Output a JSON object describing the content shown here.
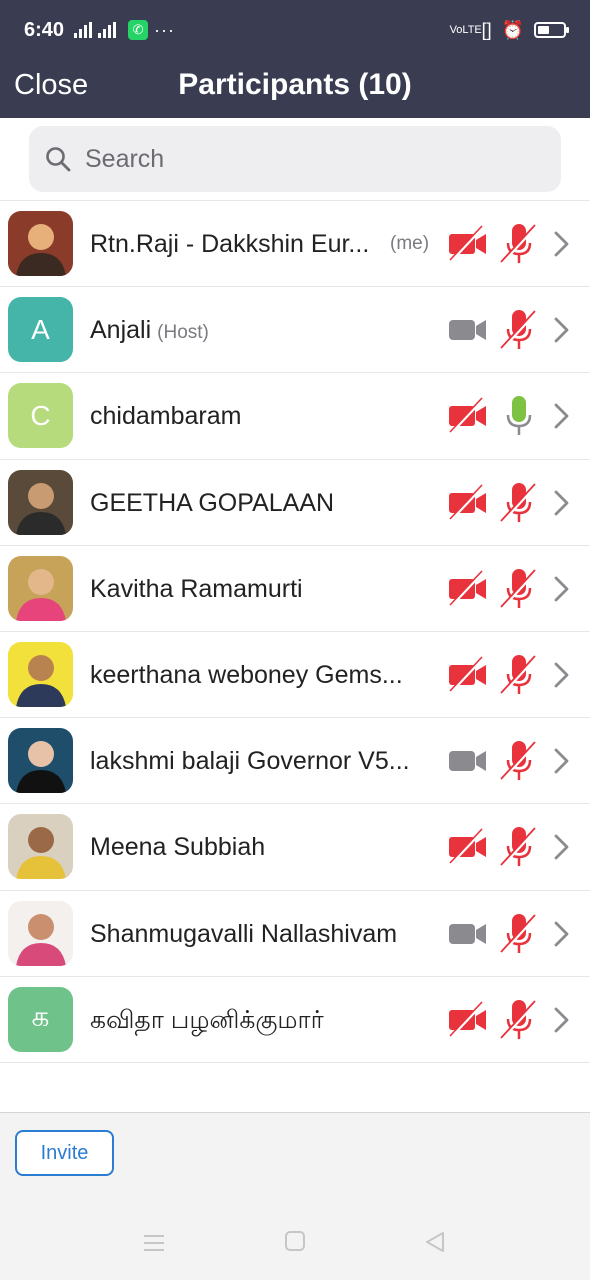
{
  "status_bar": {
    "time": "6:40",
    "network": "4G",
    "more": "···",
    "volte": "VoLTE",
    "battery_level": 0.45
  },
  "header": {
    "close_label": "Close",
    "title": "Participants (10)"
  },
  "search": {
    "placeholder": "Search"
  },
  "participants": [
    {
      "name": "Rtn.Raji - Dakkshin Eur...",
      "tag": "(me)",
      "video": "off",
      "mic": "off",
      "avatar": "photo"
    },
    {
      "name": "Anjali",
      "tag": "(Host)",
      "video": "gray",
      "mic": "off",
      "avatar": "letter",
      "initial": "A",
      "avatar_color": "#44b5a8"
    },
    {
      "name": "chidambaram",
      "tag": "",
      "video": "off",
      "mic": "on",
      "avatar": "letter",
      "initial": "C",
      "avatar_color": "#b5db7d"
    },
    {
      "name": "GEETHA GOPALAAN",
      "tag": "",
      "video": "off",
      "mic": "off",
      "avatar": "photo"
    },
    {
      "name": "Kavitha Ramamurti",
      "tag": "",
      "video": "off",
      "mic": "off",
      "avatar": "photo"
    },
    {
      "name": "keerthana weboney Gems...",
      "tag": "",
      "video": "off",
      "mic": "off",
      "avatar": "photo"
    },
    {
      "name": "lakshmi balaji Governor V5...",
      "tag": "",
      "video": "gray",
      "mic": "off",
      "avatar": "photo"
    },
    {
      "name": "Meena Subbiah",
      "tag": "",
      "video": "off",
      "mic": "off",
      "avatar": "photo"
    },
    {
      "name": "Shanmugavalli Nallashivam",
      "tag": "",
      "video": "gray",
      "mic": "off",
      "avatar": "photo"
    },
    {
      "name": "கவிதா பழனிக்குமார்",
      "tag": "",
      "video": "off",
      "mic": "off",
      "avatar": "letter",
      "initial": "க",
      "avatar_color": "#6fc28a"
    }
  ],
  "footer": {
    "invite_label": "Invite"
  },
  "colors": {
    "header_bg": "#3a3d52",
    "muted_red": "#e8323c",
    "mic_on_green": "#7dc243",
    "icon_gray": "#8a8a8f",
    "accent_blue": "#2a7dd1"
  }
}
